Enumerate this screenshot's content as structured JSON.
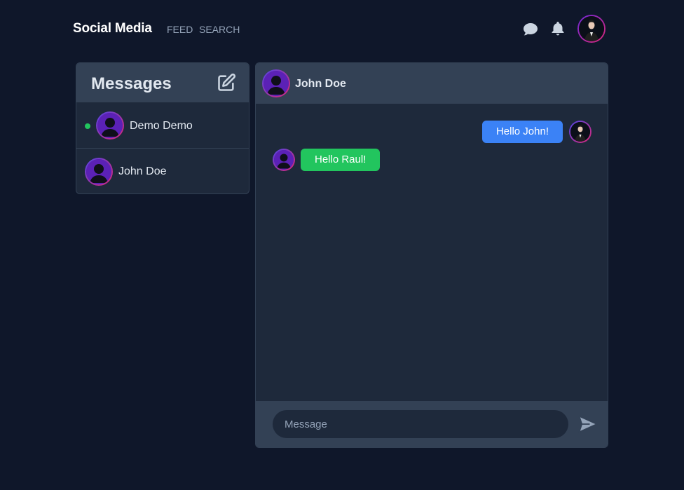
{
  "nav": {
    "brand": "Social Media",
    "links": [
      "FEED",
      "SEARCH"
    ],
    "icons": [
      "chat-bubble-icon",
      "bell-icon"
    ]
  },
  "messages": {
    "title": "Messages",
    "conversations": [
      {
        "name": "Demo Demo",
        "online": true
      },
      {
        "name": "John Doe",
        "online": false
      }
    ]
  },
  "chat": {
    "contact_name": "John Doe",
    "messages": [
      {
        "text": "Hello John!",
        "direction": "outgoing"
      },
      {
        "text": "Hello Raul!",
        "direction": "incoming"
      }
    ],
    "input_placeholder": "Message"
  },
  "colors": {
    "background": "#0f172a",
    "panel": "#1e293b",
    "panel_header": "#334155",
    "outgoing_bubble": "#3b82f6",
    "incoming_bubble": "#22c55e",
    "online": "#22c55e"
  }
}
